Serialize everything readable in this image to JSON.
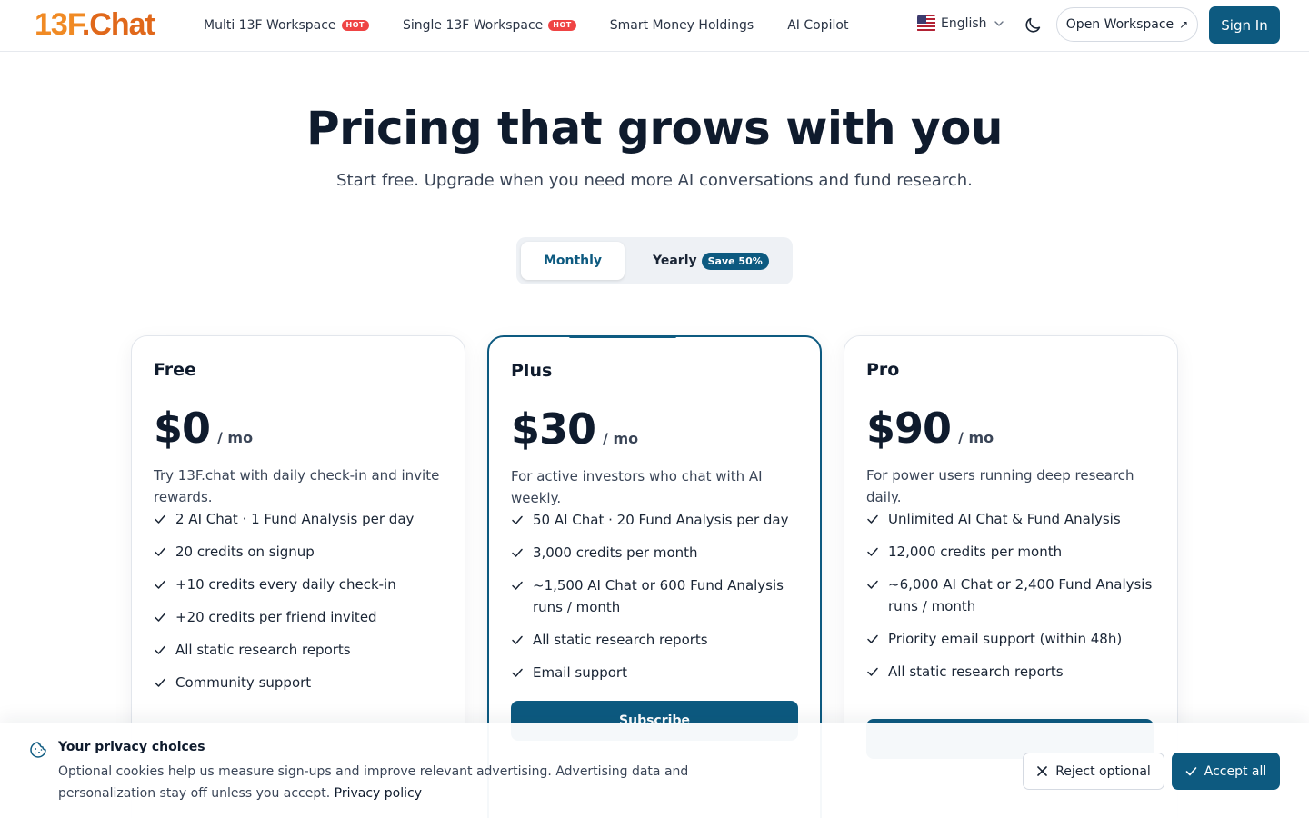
{
  "header": {
    "logo": {
      "main": "13F",
      "suffix": ".Chat"
    },
    "nav": [
      {
        "label": "Multi 13F Workspace",
        "badge": "HOT"
      },
      {
        "label": "Single 13F Workspace",
        "badge": "HOT"
      },
      {
        "label": "Smart Money Holdings",
        "badge": ""
      },
      {
        "label": "AI Copilot",
        "badge": ""
      }
    ],
    "language": "English",
    "open_workspace": "Open Workspace",
    "sign_in": "Sign In"
  },
  "hero": {
    "title": "Pricing that grows with you",
    "subtitle": "Start free. Upgrade when you need more AI conversations and fund research."
  },
  "billing_toggle": {
    "monthly": "Monthly",
    "yearly": "Yearly",
    "yearly_badge": "Save 50%",
    "selected": "Monthly"
  },
  "plans": [
    {
      "name": "Free",
      "price": "$0",
      "period": "/ mo",
      "description": "Try 13F.chat with daily check-in and invite rewards.",
      "features": [
        "2 AI Chat · 1 Fund Analysis per day",
        "20 credits on signup",
        "+10 credits every daily check-in",
        "+20 credits per friend invited",
        "All static research reports",
        "Community support"
      ]
    },
    {
      "name": "Plus",
      "price": "$30",
      "period": "/ mo",
      "description": "For active investors who chat with AI weekly.",
      "features": [
        "50 AI Chat · 20 Fund Analysis per day",
        "3,000 credits per month",
        "~1,500 AI Chat or 600 Fund Analysis runs / month",
        "All static research reports",
        "Email support"
      ],
      "cta": "Subscribe"
    },
    {
      "name": "Pro",
      "price": "$90",
      "period": "/ mo",
      "description": "For power users running deep research daily.",
      "features": [
        "Unlimited AI Chat & Fund Analysis",
        "12,000 credits per month",
        "~6,000 AI Chat or 2,400 Fund Analysis runs / month",
        "Priority email support (within 48h)",
        "All static research reports"
      ]
    }
  ],
  "cookie_banner": {
    "title": "Your privacy choices",
    "text": "Optional cookies help us measure sign-ups and improve relevant advertising. Advertising data and personalization stay off unless you accept.",
    "link": "Privacy policy",
    "reject": "Reject optional",
    "accept": "Accept all"
  },
  "colors": {
    "primary": "#0d5a80",
    "logo": "#f08a24",
    "hot_badge": "#ef4444"
  },
  "icons": [
    "flag-us-icon",
    "chevron-down-icon",
    "moon-icon",
    "external-arrow-icon",
    "check-icon",
    "cookie-icon",
    "close-icon"
  ]
}
